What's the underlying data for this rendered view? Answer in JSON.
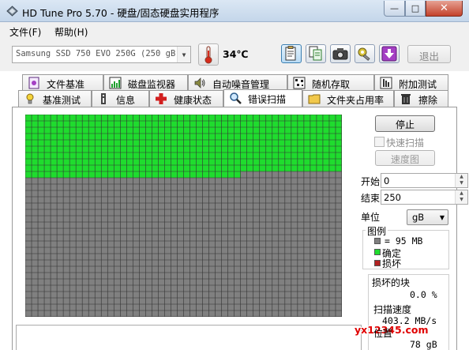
{
  "window": {
    "title": "HD Tune Pro 5.70 - 硬盘/固态硬盘实用程序",
    "minimize_label": "—",
    "maximize_label": "□",
    "close_label": "✕"
  },
  "menu": {
    "file": "文件(F)",
    "help": "帮助(H)"
  },
  "toolbar": {
    "drive": "Samsung SSD 750 EVO 250G (250 gB)",
    "temperature": "34℃",
    "exit_label": "退出"
  },
  "tabs_top": [
    {
      "label": "文件基准",
      "icon": "file-benchmark-icon"
    },
    {
      "label": "磁盘监视器",
      "icon": "disk-monitor-icon"
    },
    {
      "label": "自动噪音管理",
      "icon": "speaker-icon"
    },
    {
      "label": "随机存取",
      "icon": "random-access-icon"
    },
    {
      "label": "附加测试",
      "icon": "extra-tests-icon"
    }
  ],
  "tabs_bottom": [
    {
      "label": "基准测试",
      "icon": "benchmark-icon"
    },
    {
      "label": "信息",
      "icon": "info-icon"
    },
    {
      "label": "健康状态",
      "icon": "health-icon"
    },
    {
      "label": "错误扫描",
      "icon": "error-scan-icon",
      "active": true
    },
    {
      "label": "文件夹占用率",
      "icon": "folder-icon"
    },
    {
      "label": "擦除",
      "icon": "erase-icon"
    }
  ],
  "scan": {
    "colors": {
      "ok": "#1fdc2e",
      "pending": "#808080",
      "damaged": "#b22222",
      "grid_line": "#333333"
    },
    "columns": 50,
    "rows": 32,
    "green_full_rows": 9,
    "green_partial_row_cols": 34,
    "stop_label": "停止",
    "quick_scan_label": "快速扫描",
    "speed_map_label": "速度图",
    "start_label": "开始",
    "start_value": "0",
    "end_label": "结束",
    "end_value": "250",
    "unit_label": "单位",
    "unit_value": "gB",
    "legend_title": "图例",
    "legend_block": "= 95 MB",
    "legend_ok": "确定",
    "legend_damaged": "损坏",
    "damaged_blocks_label": "损坏的块",
    "damaged_blocks_value": "0.0 %",
    "scan_speed_label": "扫描速度",
    "scan_speed_value": "403.2 MB/s",
    "position_label": "位置",
    "position_value": "78 gB"
  },
  "watermark": "yx12345.com"
}
